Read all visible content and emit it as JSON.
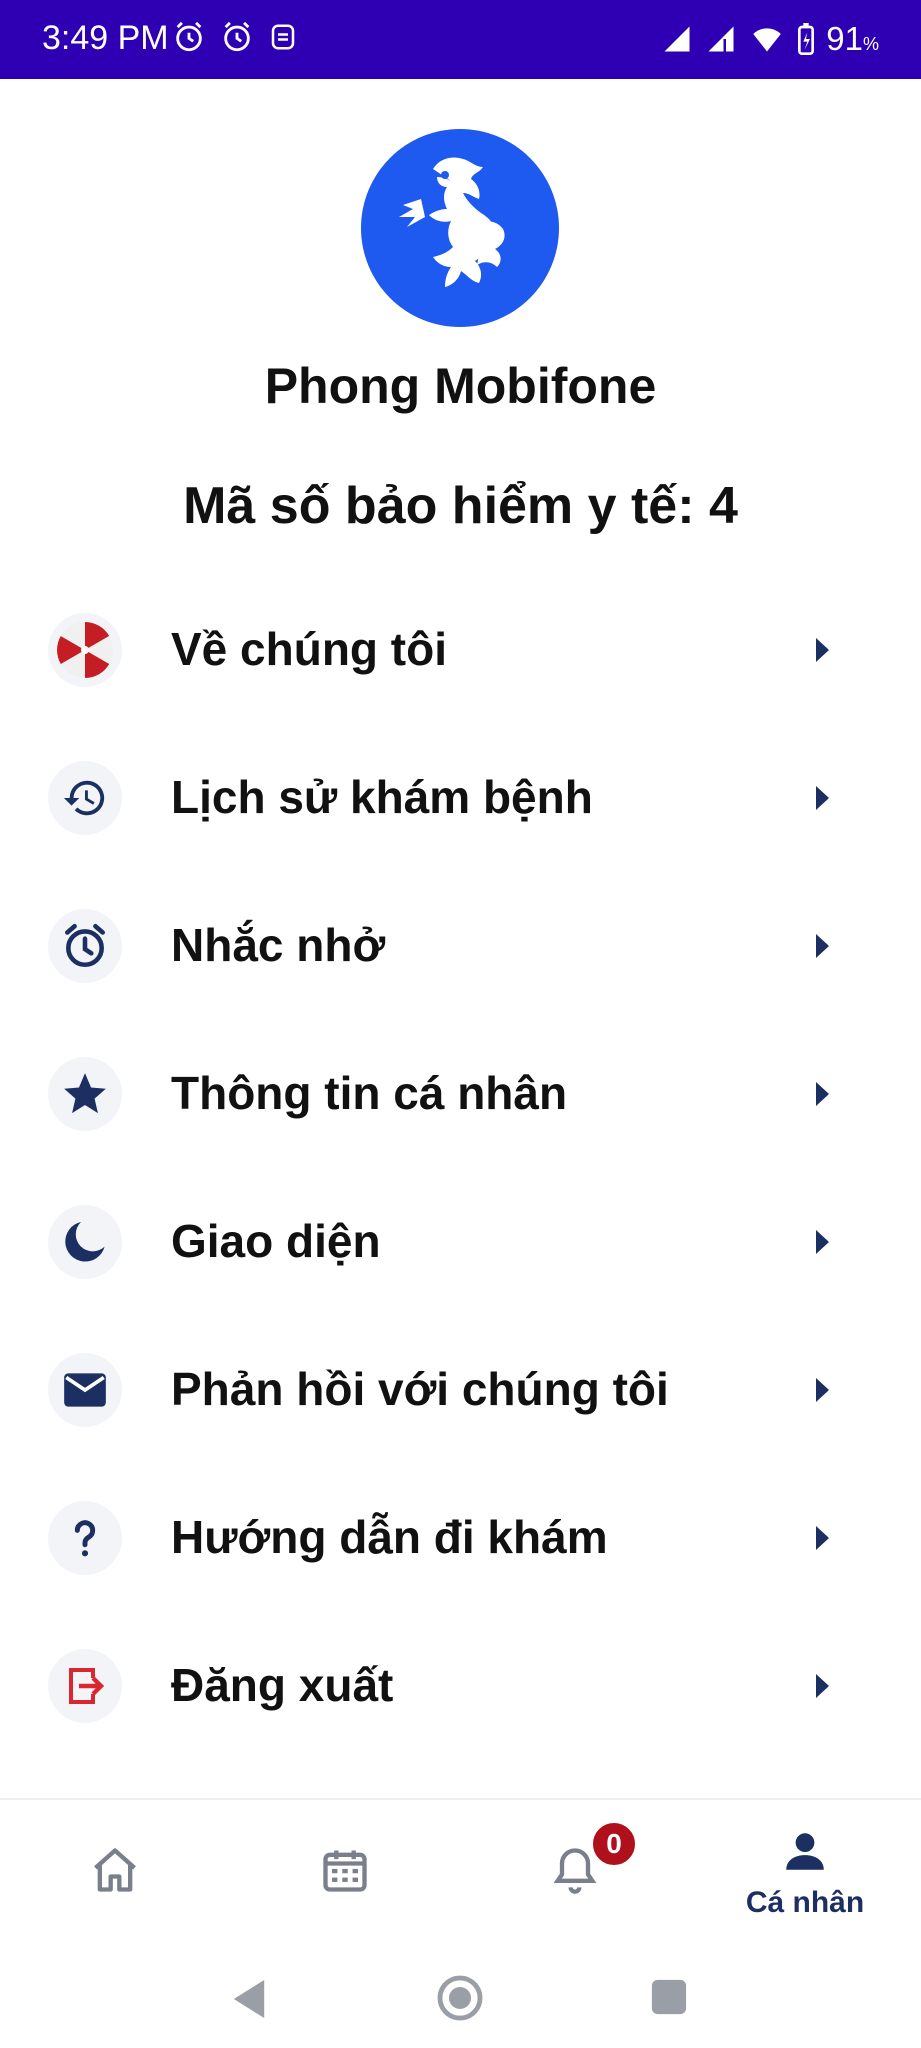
{
  "status_bar": {
    "time": "3:49 PM",
    "battery_percent": "91",
    "battery_unit": "%",
    "icons": [
      "alarm-icon",
      "alarm-icon",
      "sync-icon",
      "signal-icon",
      "signal-icon",
      "wifi-icon",
      "battery-icon"
    ]
  },
  "profile": {
    "name": "Phong Mobifone",
    "insurance_text": "Mã số bảo hiểm y tế: 4",
    "avatar_color": "#1f5af0"
  },
  "menu": {
    "items": [
      {
        "label": "Về chúng tôi",
        "icon": "umbrella-logo-icon"
      },
      {
        "label": "Lịch sử khám bệnh",
        "icon": "history-icon"
      },
      {
        "label": "Nhắc nhở",
        "icon": "alarm-icon"
      },
      {
        "label": "Thông tin cá nhân",
        "icon": "star-icon"
      },
      {
        "label": "Giao diện",
        "icon": "moon-icon"
      },
      {
        "label": "Phản hồi với chúng tôi",
        "icon": "mail-icon"
      },
      {
        "label": "Hướng dẫn đi khám",
        "icon": "help-icon"
      },
      {
        "label": "Đăng xuất",
        "icon": "logout-icon"
      }
    ]
  },
  "bottom_nav": {
    "items": [
      {
        "icon": "home-icon",
        "label": ""
      },
      {
        "icon": "calendar-icon",
        "label": ""
      },
      {
        "icon": "bell-icon",
        "label": "",
        "badge": "0"
      },
      {
        "icon": "person-icon",
        "label": "Cá nhân",
        "active": true
      }
    ]
  },
  "colors": {
    "status_bar": "#2f00b3",
    "primary_dark": "#1b2f63",
    "badge": "#b0101c",
    "logout": "#d9262f"
  }
}
